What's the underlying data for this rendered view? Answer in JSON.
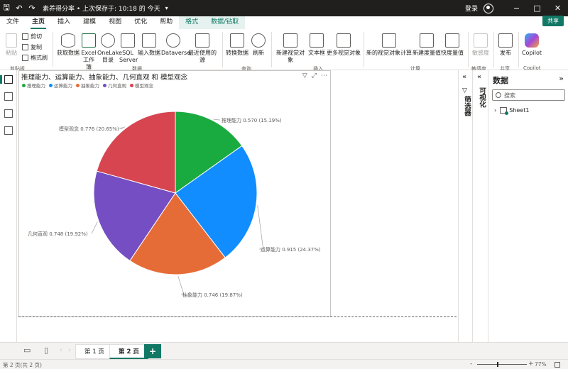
{
  "titlebar": {
    "doc_title": "素养得分率 • 上次保存于: 10:18 的 今天",
    "signin": "登录",
    "save_icon": "save-icon",
    "undo_icon": "undo-icon",
    "redo_icon": "redo-icon"
  },
  "ribbon_tabs": [
    {
      "label": "文件"
    },
    {
      "label": "主页"
    },
    {
      "label": "插入"
    },
    {
      "label": "建模"
    },
    {
      "label": "视图"
    },
    {
      "label": "优化"
    },
    {
      "label": "帮助"
    },
    {
      "label": "格式"
    },
    {
      "label": "数据/钻取"
    }
  ],
  "share_label": "共享",
  "ribbon": {
    "clipboard": {
      "paste": "粘贴",
      "cut": "剪切",
      "copy": "复制",
      "format_painter": "格式刷",
      "group": "剪贴板"
    },
    "data": {
      "get_data": "获取数据",
      "excel": "Excel 工作簿",
      "onelake": "OneLake 目录",
      "sql": "SQL Server",
      "enter_data": "输入数据",
      "dataverse": "Dataverse",
      "recent": "最近使用的源",
      "group": "数据"
    },
    "query": {
      "transform": "转换数据",
      "refresh": "刷新",
      "group": "查询"
    },
    "insert": {
      "new_visual": "新建视觉对象",
      "textbox": "文本框",
      "more_visuals": "更多视觉对象",
      "group": "插入"
    },
    "calc": {
      "new_visual_calc": "新的视觉对象计算",
      "new_measure": "新建度量值",
      "quick_measure": "快度量值",
      "group": "计算"
    },
    "sensitivity": {
      "label": "敏感度",
      "group": "敏感度"
    },
    "share": {
      "publish": "发布",
      "group": "共享"
    },
    "copilot": {
      "label": "Copilot",
      "group": "Copilot"
    }
  },
  "visual": {
    "title": "推理能力、运算能力、抽象能力、几何直观 和 模型观念"
  },
  "chart_data": {
    "type": "pie",
    "title": "推理能力、运算能力、抽象能力、几何直观 和 模型观念",
    "legend_position": "top-left",
    "categories": [
      "推理能力",
      "运算能力",
      "抽象能力",
      "几何直观",
      "模型观念"
    ],
    "values": [
      0.57,
      0.915,
      0.746,
      0.748,
      0.776
    ],
    "percent_labels": [
      "15.19%",
      "24.37%",
      "19.87%",
      "19.92%",
      "20.65%"
    ],
    "data_labels": [
      "推理能力 0.570 (15.19%)",
      "运算能力 0.915 (24.37%)",
      "抽象能力 0.746 (19.87%)",
      "几何直观 0.748 (19.92%)",
      "模型观念 0.776 (20.65%)"
    ],
    "colors": [
      "#1aab40",
      "#118dff",
      "#e66c37",
      "#744ec2",
      "#d64550"
    ]
  },
  "panes": {
    "filters": "筛选器",
    "visualizations": "可视化",
    "data_title": "数据",
    "search_placeholder": "搜索",
    "table_name": "Sheet1"
  },
  "pages": [
    {
      "label": "第 1 页"
    },
    {
      "label": "第 2 页"
    }
  ],
  "add_page": "+",
  "status": {
    "page_info": "第 2 页(共 2 页)",
    "zoom": "77%",
    "zoom_minus": "-",
    "zoom_plus": "+"
  }
}
